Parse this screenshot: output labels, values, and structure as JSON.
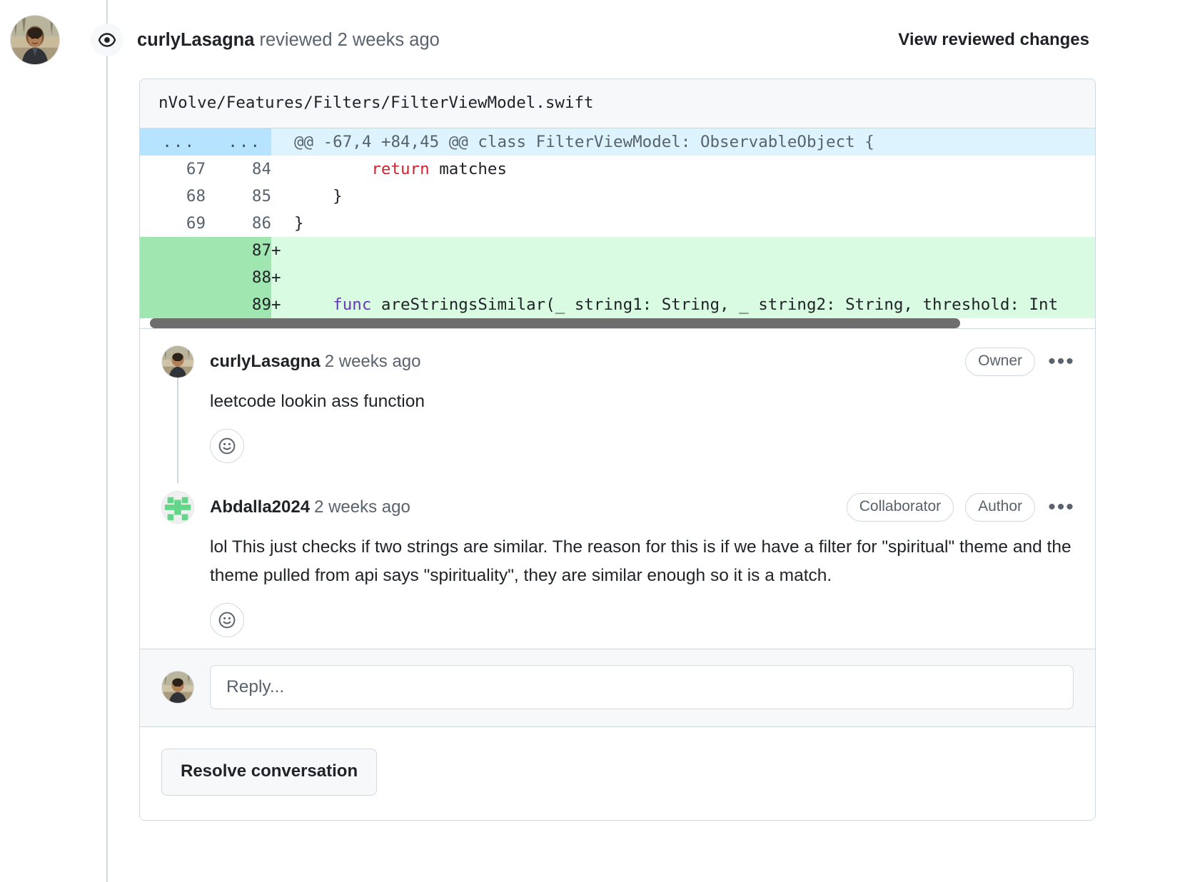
{
  "header": {
    "actor": "curlyLasagna",
    "action": " reviewed 2 weeks ago",
    "view_changes_label": "View reviewed changes",
    "eye_icon": "eye-icon"
  },
  "diff": {
    "filename": "nVolve/Features/Filters/FilterViewModel.swift",
    "hunk_marker": "...",
    "hunk_header": "@@ -67,4 +84,45 @@ class FilterViewModel: ObservableObject {",
    "rows": [
      {
        "old": "67",
        "new": "84",
        "sign": "",
        "kind": "ctx",
        "code_pre": "        ",
        "code_kw": "return",
        "code_kw_color": "red",
        "code_post": " matches"
      },
      {
        "old": "68",
        "new": "85",
        "sign": "",
        "kind": "ctx",
        "code_pre": "    }",
        "code_kw": "",
        "code_kw_color": "",
        "code_post": ""
      },
      {
        "old": "69",
        "new": "86",
        "sign": "",
        "kind": "ctx",
        "code_pre": "}",
        "code_kw": "",
        "code_kw_color": "",
        "code_post": ""
      },
      {
        "old": "",
        "new": "87",
        "sign": "+",
        "kind": "add",
        "code_pre": "",
        "code_kw": "",
        "code_kw_color": "",
        "code_post": ""
      },
      {
        "old": "",
        "new": "88",
        "sign": "+",
        "kind": "add",
        "code_pre": "",
        "code_kw": "",
        "code_kw_color": "",
        "code_post": ""
      },
      {
        "old": "",
        "new": "89",
        "sign": "+",
        "kind": "add",
        "code_pre": "    ",
        "code_kw": "func",
        "code_kw_color": "purple",
        "code_post": " areStringsSimilar(_ string1: String, _ string2: String, threshold: Int"
      }
    ]
  },
  "comments": [
    {
      "author": "curlyLasagna",
      "when": "2 weeks ago",
      "badges": [
        "Owner"
      ],
      "body": "leetcode lookin ass function",
      "avatar_kind": "photo",
      "kebab": "•••",
      "reaction_icon": "emoji-smiley-icon"
    },
    {
      "author": "Abdalla2024",
      "when": "2 weeks ago",
      "badges": [
        "Collaborator",
        "Author"
      ],
      "body": "lol This just checks if two strings are similar. The reason for this is if we have a filter for \"spiritual\" theme and the theme pulled from api says \"spirituality\", they are similar enough so it is a match.",
      "avatar_kind": "identicon",
      "kebab": "•••",
      "reaction_icon": "emoji-smiley-icon"
    }
  ],
  "reply": {
    "placeholder": "Reply...",
    "value": ""
  },
  "actions": {
    "resolve_label": "Resolve conversation"
  },
  "colors": {
    "add_bg": "#d9fbe1",
    "add_gutter": "#a0e6b1",
    "hunk_bg": "#ddf4ff",
    "hunk_gutter": "#b6e3ff",
    "keyword_red": "#cf222e",
    "keyword_purple": "#6639ba",
    "border": "#d1d9e0",
    "muted_text": "#59636e"
  }
}
